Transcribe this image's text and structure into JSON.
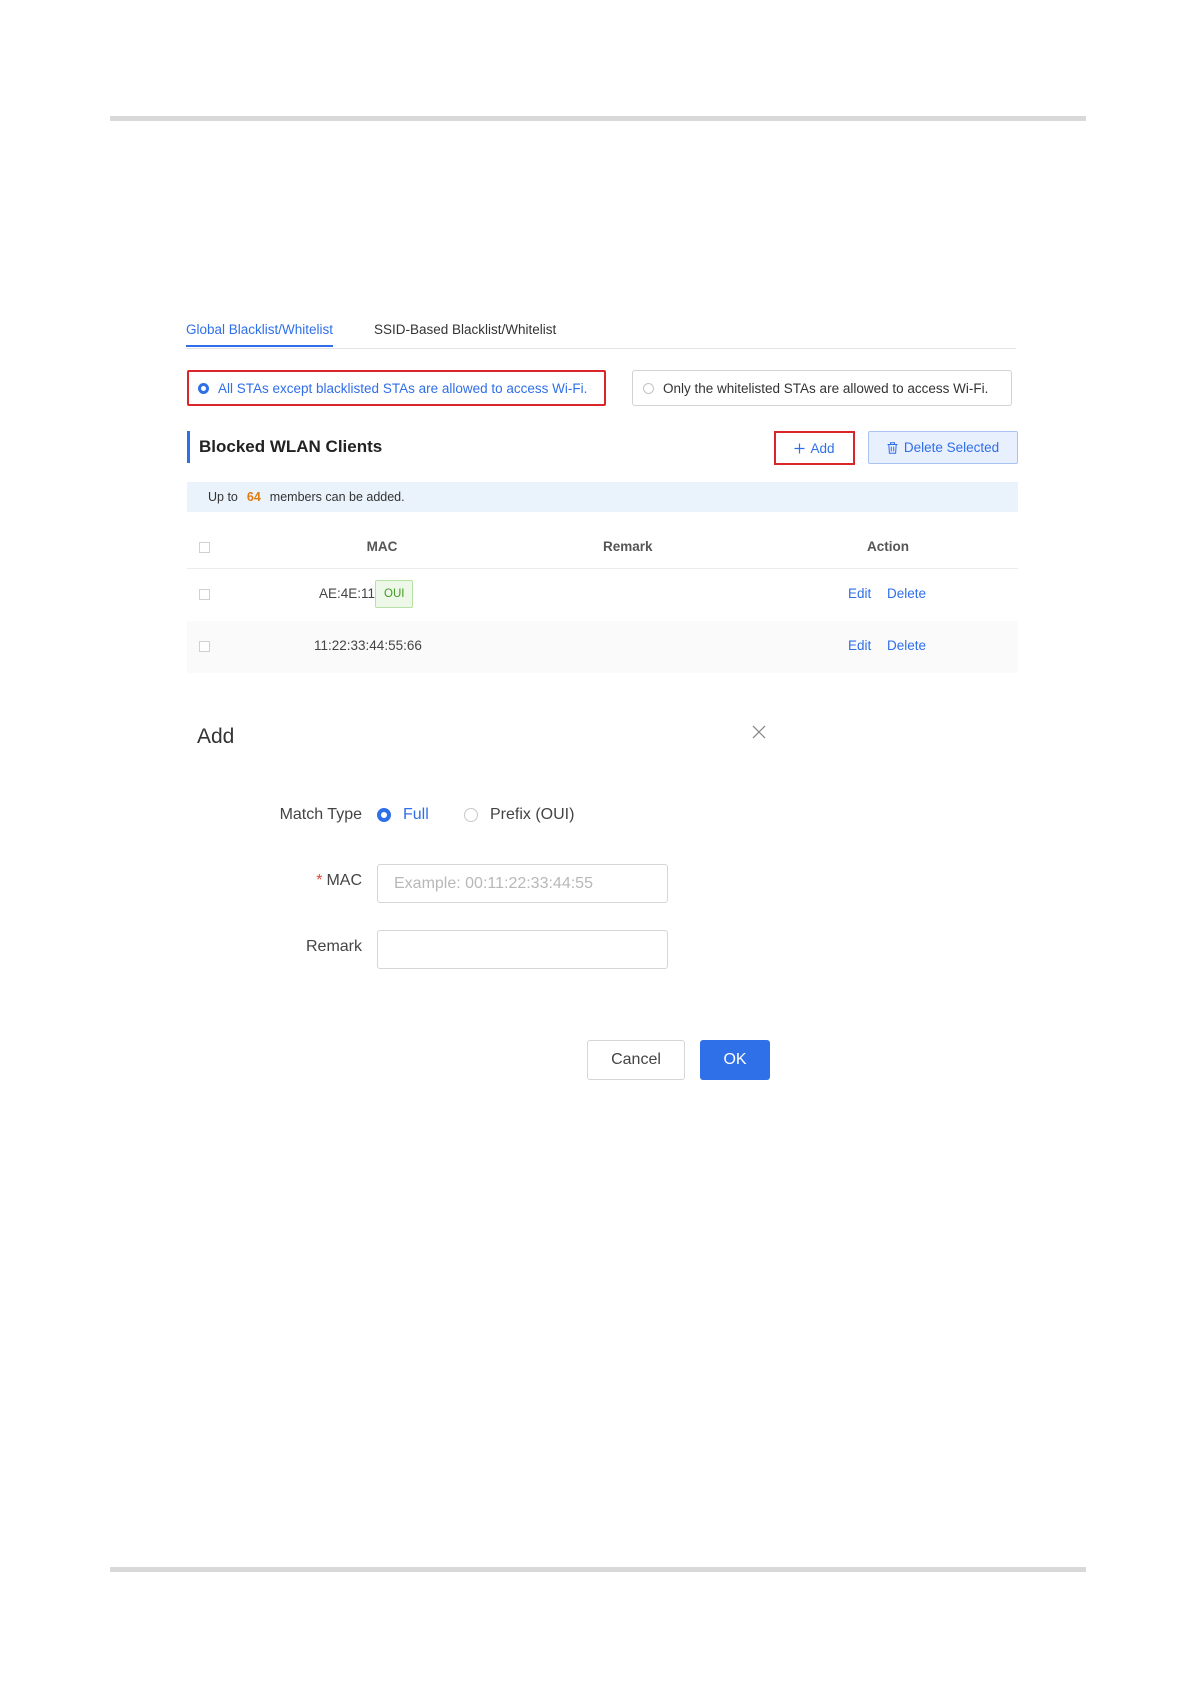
{
  "tabs": [
    {
      "label": "Global Blacklist/Whitelist",
      "active": true
    },
    {
      "label": "SSID-Based Blacklist/Whitelist",
      "active": false
    }
  ],
  "mode": {
    "options": [
      {
        "label": "All STAs except blacklisted STAs are allowed to access Wi-Fi.",
        "selected": true
      },
      {
        "label": "Only the whitelisted STAs are allowed to access Wi-Fi.",
        "selected": false
      }
    ]
  },
  "section": {
    "title": "Blocked WLAN Clients",
    "add_label": "Add",
    "delete_selected_label": "Delete Selected"
  },
  "info": {
    "prefix": "Up to",
    "max_members": "64",
    "suffix": "members can be added."
  },
  "table": {
    "columns": [
      "MAC",
      "Remark",
      "Action"
    ],
    "rows": [
      {
        "mac": "AE:4E:11",
        "badge": "OUI",
        "remark": "",
        "edit": "Edit",
        "delete": "Delete"
      },
      {
        "mac": "11:22:33:44:55:66",
        "badge": "",
        "remark": "",
        "edit": "Edit",
        "delete": "Delete"
      }
    ]
  },
  "dialog": {
    "title": "Add",
    "match_type_label": "Match Type",
    "match_options": [
      {
        "label": "Full",
        "selected": true
      },
      {
        "label": "Prefix (OUI)",
        "selected": false
      }
    ],
    "required_mark": "*",
    "mac_label": "MAC",
    "mac_placeholder": "Example: 00:11:22:33:44:55",
    "mac_value": "",
    "remark_label": "Remark",
    "remark_value": "",
    "cancel_label": "Cancel",
    "ok_label": "OK"
  },
  "colors": {
    "accent": "#2f6fe8",
    "highlight_border": "#d9262a",
    "count": "#e07b12",
    "oui_badge": "#3f9a1f"
  },
  "icons": {
    "add": "plus-icon",
    "delete_selected": "trash-icon",
    "dialog_close": "close-icon"
  }
}
